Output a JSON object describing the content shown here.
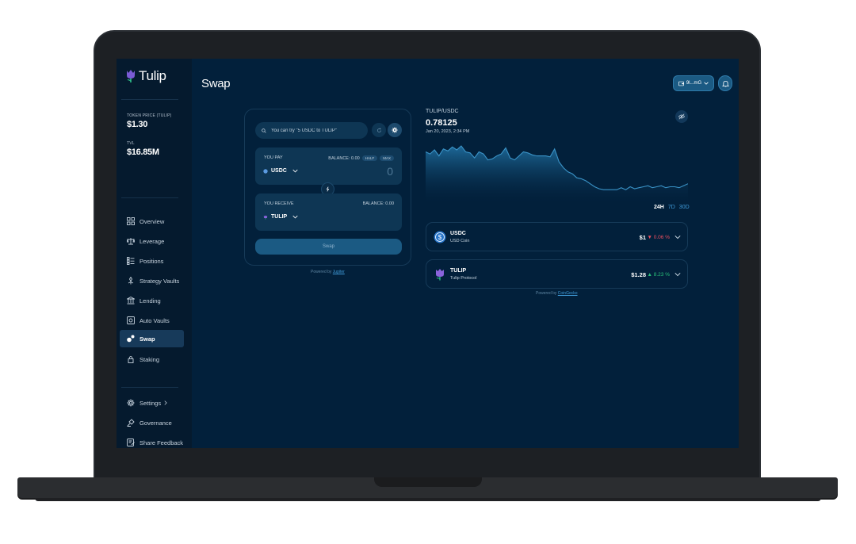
{
  "app": {
    "logo_text": "Tulip",
    "page_title": "Swap"
  },
  "sidebar": {
    "stats": [
      {
        "label": "TOKEN PRICE (TULIP)",
        "value": "$1.30"
      },
      {
        "label": "TVL",
        "value": "$16.85M"
      }
    ],
    "nav": [
      {
        "label": "Overview",
        "icon": "grid-icon"
      },
      {
        "label": "Leverage",
        "icon": "scales-icon"
      },
      {
        "label": "Positions",
        "icon": "list-icon"
      },
      {
        "label": "Strategy Vaults",
        "icon": "strategy-icon"
      },
      {
        "label": "Lending",
        "icon": "bank-icon"
      },
      {
        "label": "Auto Vaults",
        "icon": "vault-icon"
      },
      {
        "label": "Swap",
        "icon": "swap-icon",
        "active": true
      },
      {
        "label": "Staking",
        "icon": "lock-icon"
      }
    ],
    "footer": [
      {
        "label": "Settings",
        "icon": "gear-icon"
      },
      {
        "label": "Governance",
        "icon": "governance-icon"
      },
      {
        "label": "Share Feedback",
        "icon": "feedback-icon"
      }
    ]
  },
  "header": {
    "wallet_label": "9l...mG"
  },
  "swap": {
    "search_placeholder": "You can try \"5 USDC to TULIP\"",
    "pay": {
      "label": "YOU PAY",
      "balance": "BALANCE: 0.00",
      "half": "HALF",
      "max": "MAX",
      "token": "USDC",
      "amount": "0"
    },
    "receive": {
      "label": "YOU RECEIVE",
      "balance": "BALANCE: 0.00",
      "token": "TULIP"
    },
    "button_label": "Swap",
    "powered_prefix": "Powered by ",
    "powered_link": "Jupiter"
  },
  "chart": {
    "pair": "TULIP/USDC",
    "price": "0.78125",
    "date": "Jan 20, 2023, 2:34 PM",
    "ranges": [
      "24H",
      "7D",
      "30D"
    ],
    "active_range": "24H",
    "powered_prefix": "Powered by ",
    "powered_link": "CoinGecko"
  },
  "chart_data": {
    "type": "area",
    "title": "",
    "xlabel": "",
    "ylabel": "",
    "values": [
      0.85,
      0.848,
      0.852,
      0.846,
      0.853,
      0.851,
      0.855,
      0.852,
      0.856,
      0.85,
      0.849,
      0.844,
      0.85,
      0.848,
      0.842,
      0.843,
      0.846,
      0.848,
      0.854,
      0.844,
      0.842,
      0.846,
      0.85,
      0.849,
      0.847,
      0.846,
      0.846,
      0.846,
      0.845,
      0.853,
      0.84,
      0.834,
      0.83,
      0.828,
      0.824,
      0.823,
      0.821,
      0.818,
      0.815,
      0.813,
      0.812,
      0.812,
      0.812,
      0.812,
      0.814,
      0.812,
      0.815,
      0.813,
      0.814,
      0.815,
      0.816,
      0.814,
      0.815,
      0.816,
      0.814,
      0.815,
      0.815,
      0.814,
      0.816,
      0.818
    ],
    "ylim": [
      0.805,
      0.86
    ],
    "color": "#3a93c7"
  },
  "coins": [
    {
      "symbol": "USDC",
      "name": "USD Coin",
      "price": "$1",
      "change": "▼ 0.06 %",
      "direction": "neg"
    },
    {
      "symbol": "TULIP",
      "name": "Tulip Protocol",
      "price": "$1.28",
      "change": "▲ 8.23 %",
      "direction": "pos"
    }
  ],
  "colors": {
    "background": "#02203b",
    "sidebar": "#051a2e",
    "accent": "#1b5a83",
    "positive": "#29c07a",
    "negative": "#ef4f5f"
  }
}
